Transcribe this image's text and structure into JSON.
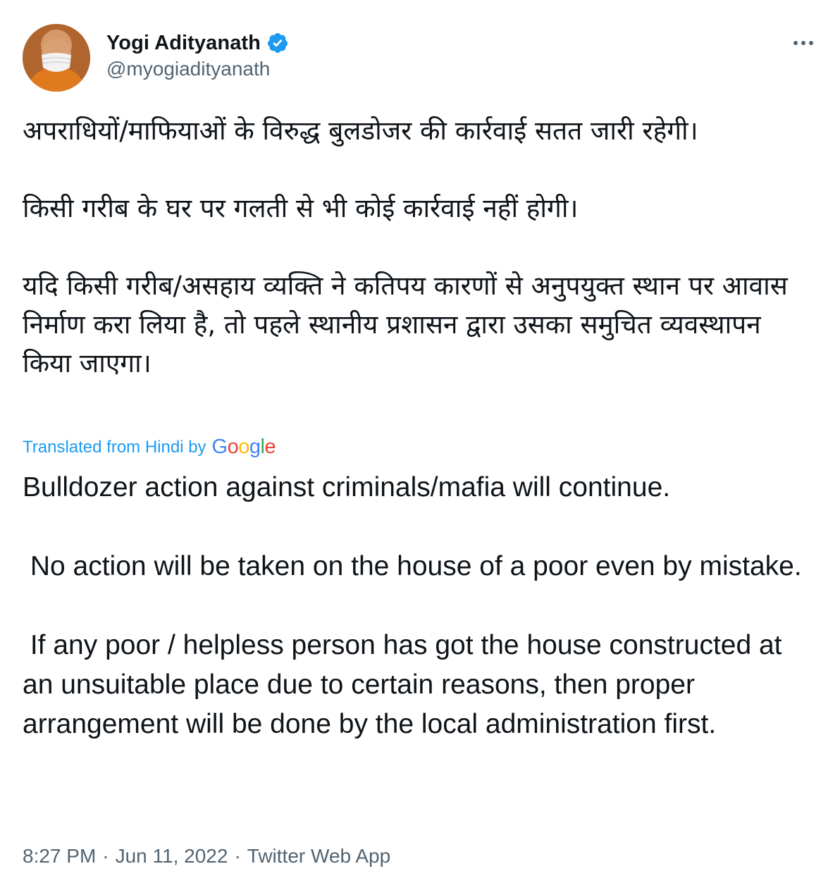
{
  "author": {
    "display_name": "Yogi Adityanath",
    "handle": "@myogiadityanath",
    "verified": true,
    "avatar_icon": "avatar"
  },
  "more_icon": "more-horizontal-icon",
  "tweet": {
    "original_text": "अपराधियों/माफियाओं के विरुद्ध बुलडोजर की कार्रवाई सतत जारी रहेगी।\n\nकिसी गरीब के घर पर गलती से भी कोई कार्रवाई नहीं होगी।\n\nयदि किसी गरीब/असहाय व्यक्ति ने कतिपय कारणों से अनुपयुक्त स्थान पर आवास निर्माण करा लिया है, तो पहले स्थानीय प्रशासन द्वारा उसका समुचित व्यवस्थापन किया जाएगा।",
    "translated_label": "Translated from Hindi by",
    "translator_logo_text": "Google",
    "translation_text": "Bulldozer action against criminals/mafia will continue.\n\n No action will be taken on the house of a poor even by mistake.\n\n If any poor / helpless person has got the house constructed at an unsuitable place due to certain reasons, then proper arrangement will be done by the local administration first."
  },
  "meta": {
    "time": "8:27 PM",
    "separator": "·",
    "date": "Jun 11, 2022",
    "source": "Twitter Web App"
  },
  "colors": {
    "accent": "#1d9bf0",
    "text": "#0f1419",
    "secondary": "#536471"
  }
}
